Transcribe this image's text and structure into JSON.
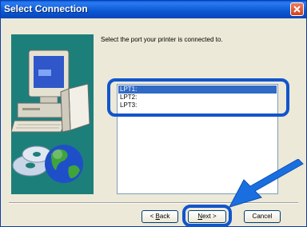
{
  "window": {
    "title": "Select Connection"
  },
  "prompt": "Select the port your printer is connected to.",
  "ports": [
    {
      "label": "LPT1:",
      "selected": true
    },
    {
      "label": "LPT2:",
      "selected": false
    },
    {
      "label": "LPT3:",
      "selected": false
    }
  ],
  "buttons": {
    "back_mnemonic": "B",
    "back_rest": "ack",
    "next_mnemonic": "N",
    "next_rest": "ext",
    "cancel": "Cancel"
  },
  "colors": {
    "highlight": "#1155cc",
    "selection": "#316ac5",
    "illustration_bg": "#1d7f7a"
  },
  "icons": {
    "illustration": "computer-with-cd-and-globe-icon",
    "pointer": "arrow-pointer-icon",
    "close": "close-icon"
  }
}
